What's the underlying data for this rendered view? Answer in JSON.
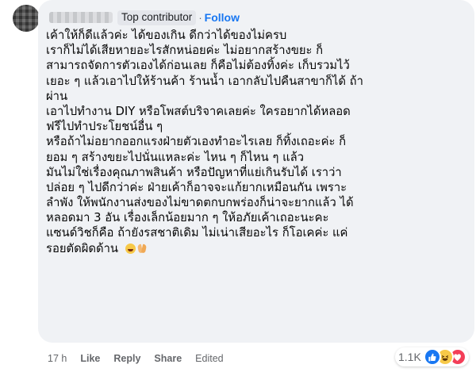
{
  "comment": {
    "author_badge": "Top contributor",
    "separator": "·",
    "follow_label": "Follow",
    "lines": [
      "เค้าให้ก็ดีแล้วค่ะ ได้ของเกิน ดีกว่าได้ของไม่ครบ",
      "เราก็ไม่ได้เสียหายอะไรสักหน่อยค่ะ ไม่อยากสร้างขยะ ก็",
      "สามารถจัดการตัวเองได้ก่อนเลย ก็คือไม่ต้องทิ้งค่ะ เก็บรวมไว้",
      "เยอะ ๆ แล้วเอาไปให้ร้านค้า ร้านน้ำ เอากลับไปคืนสาขาก็ได้ ถ้า",
      "ผ่าน",
      "เอาไปทำงาน DIY หรือโพสต์บริจาคเลยค่ะ ใครอยากได้หลอด",
      "ฟรีไปทำประโยชน์อื่น ๆ",
      "หรือถ้าไม่อยากออกแรงฝ่ายตัวเองทำอะไรเลย ก็ทิ้งเถอะค่ะ ก็",
      "ยอม ๆ สร้างขยะไปนั่นแหละค่ะ ไหน ๆ ก็ไหน ๆ แล้ว",
      "มันไม่ใช่เรื่องคุณภาพสินค้า หรือปัญหาที่แย่เกินรับได้ เราว่า",
      "ปล่อย ๆ ไปดีกว่าค่ะ ฝ่ายเค้าก็อาจจะแก้ยากเหมือนกัน เพราะ",
      "ลำพัง ให้พนักงานส่งของไม่ขาดตกบกพร่องก็น่าจะยากแล้ว ได้",
      "หลอดมา 3 อัน เรื่องเล็กน้อยมาก ๆ ให้อภัยเค้าเถอะนะคะ",
      "แซนด์วิชก็คือ ถ้ายังรสชาติเดิม ไม่เน่าเสียอะไร ก็โอเคค่ะ แค่",
      "รอยตัดผิดด้าน"
    ],
    "emojis": [
      "laughing-emoji",
      "praying-hands-emoji"
    ]
  },
  "actions": {
    "time": "17 h",
    "like": "Like",
    "reply": "Reply",
    "share": "Share",
    "edited": "Edited"
  },
  "reactions": {
    "count": "1.1K",
    "icons": [
      "like-icon",
      "haha-icon",
      "love-icon"
    ],
    "colors": {
      "like": "#1877f2",
      "haha": "#f7c948",
      "love": "#f33e58"
    }
  },
  "colors": {
    "bubble": "#f0f2f5",
    "link": "#1877f2",
    "muted": "#65676b",
    "text": "#050505"
  }
}
